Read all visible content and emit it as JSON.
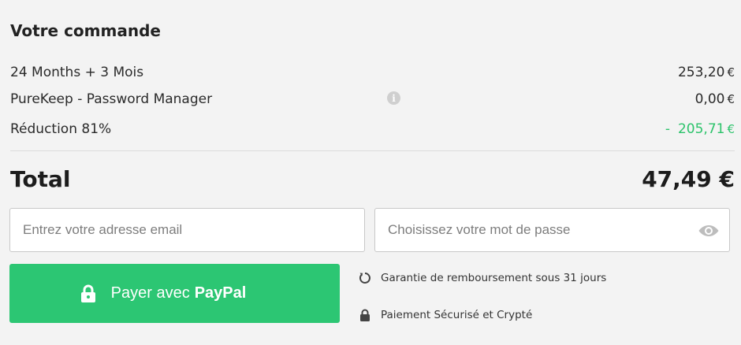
{
  "order": {
    "title": "Votre commande",
    "lines": [
      {
        "label": "24 Months + 3 Mois",
        "amount": "253,20",
        "currency": "€"
      },
      {
        "label": "PureKeep - Password Manager",
        "amount": "0,00",
        "currency": "€",
        "info_icon": "info-icon"
      },
      {
        "label": "Réduction 81%",
        "sign": "-",
        "amount": "205,71",
        "currency": "€"
      }
    ],
    "total_label": "Total",
    "total_amount": "47,49 €"
  },
  "form": {
    "email_placeholder": "Entrez votre adresse email",
    "password_placeholder": "Choisissez votre mot de passe",
    "password_toggle_icon": "eye-icon"
  },
  "pay": {
    "label": "Payer avec",
    "brand": "PayPal",
    "icon": "lock-icon"
  },
  "assurances": [
    {
      "icon": "refresh-icon",
      "text": "Garantie de remboursement sous 31 jours"
    },
    {
      "icon": "lock-icon",
      "text": "Paiement Sécurisé et Crypté"
    }
  ],
  "colors": {
    "accent_green": "#2cc673",
    "discount_green": "#2cc36b",
    "background": "#f3f3f3"
  }
}
